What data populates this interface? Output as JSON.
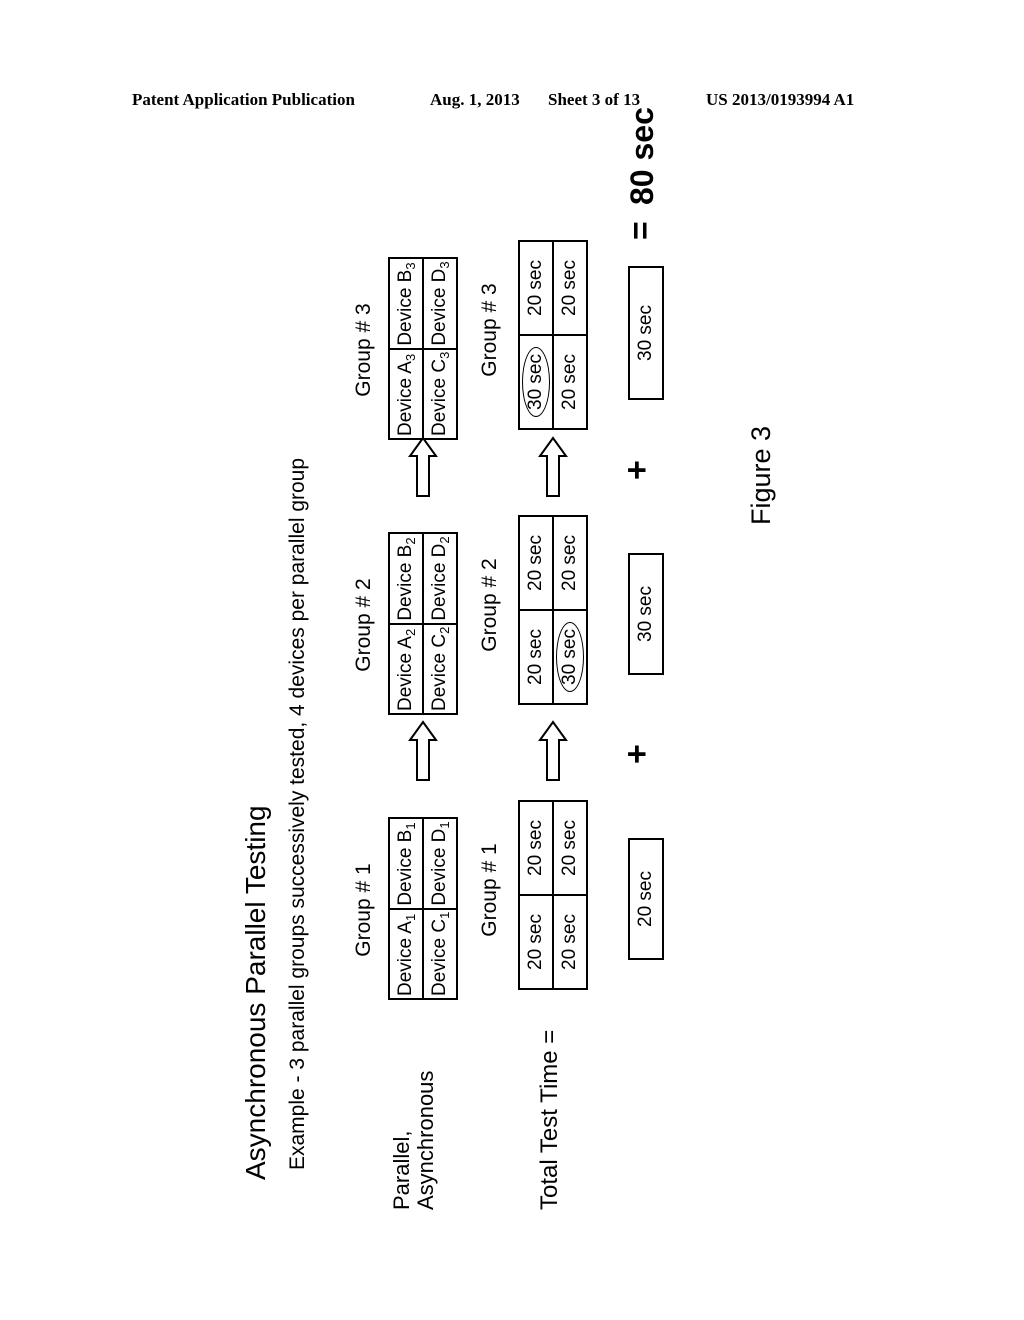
{
  "header": {
    "left": "Patent Application Publication",
    "date": "Aug. 1, 2013",
    "sheet": "Sheet 3 of 13",
    "number": "US 2013/0193994 A1"
  },
  "diagram": {
    "title": "Asynchronous Parallel Testing",
    "subtitle": "Example  - 3 parallel groups successively tested, 4 devices per parallel group",
    "row_label_devices_line1": "Parallel,",
    "row_label_devices_line2": "Asynchronous",
    "row_label_time": "Total Test Time =",
    "device_word": "Device",
    "groups": [
      {
        "label": "Group # 1",
        "index": "1",
        "devices": [
          "A",
          "B",
          "C",
          "D"
        ],
        "times": [
          "20 sec",
          "20 sec",
          "20 sec",
          "20 sec"
        ],
        "circled_time_index": null,
        "group_time": "20 sec"
      },
      {
        "label": "Group # 2",
        "index": "2",
        "devices": [
          "A",
          "B",
          "C",
          "D"
        ],
        "times": [
          "20 sec",
          "20 sec",
          "30 sec",
          "20 sec"
        ],
        "circled_time_index": 2,
        "group_time": "30 sec"
      },
      {
        "label": "Group # 3",
        "index": "3",
        "devices": [
          "A",
          "B",
          "C",
          "D"
        ],
        "times": [
          "30 sec",
          "20 sec",
          "20 sec",
          "20 sec"
        ],
        "circled_time_index": 0,
        "group_time": "30 sec"
      }
    ],
    "plus_sign": "+",
    "equals_sign": "=",
    "total": "80 sec",
    "figure_label": "Figure 3"
  }
}
